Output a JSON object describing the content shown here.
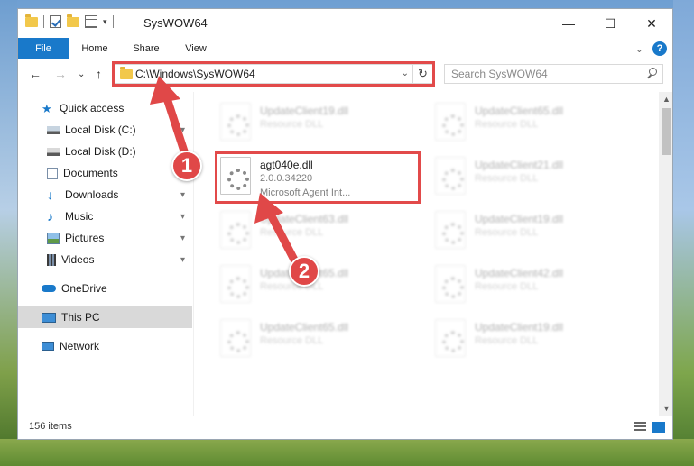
{
  "window": {
    "title": "SysWOW64",
    "minimize_glyph": "—",
    "maximize_glyph": "☐",
    "close_glyph": "✕"
  },
  "ribbon": {
    "tabs": [
      "File",
      "Home",
      "Share",
      "View"
    ],
    "collapse_glyph": "⌄",
    "help_glyph": "?"
  },
  "nav": {
    "back_glyph": "←",
    "forward_glyph": "→",
    "recent_glyph": "⌄",
    "up_glyph": "↑",
    "address": "C:\\Windows\\SysWOW64",
    "address_drop_glyph": "⌄",
    "refresh_glyph": "↻",
    "search_placeholder": "Search SysWOW64"
  },
  "sidebar": {
    "items": [
      {
        "label": "Quick access",
        "icon": "star-icon"
      },
      {
        "label": "Local Disk (C:)",
        "icon": "drive-icon",
        "pinned": true
      },
      {
        "label": "Local Disk (D:)",
        "icon": "drive-icon",
        "pinned": true
      },
      {
        "label": "Documents",
        "icon": "documents-icon",
        "pinned": true
      },
      {
        "label": "Downloads",
        "icon": "downloads-icon",
        "pinned": true
      },
      {
        "label": "Music",
        "icon": "music-icon",
        "pinned": true
      },
      {
        "label": "Pictures",
        "icon": "pictures-icon",
        "pinned": true
      },
      {
        "label": "Videos",
        "icon": "videos-icon",
        "pinned": true
      },
      {
        "label": "OneDrive",
        "icon": "onedrive-icon"
      },
      {
        "label": "This PC",
        "icon": "computer-icon",
        "selected": true
      },
      {
        "label": "Network",
        "icon": "network-icon"
      }
    ],
    "pin_glyph": "📌"
  },
  "files": {
    "left_column": [
      {
        "name": "UpdateClient19.dll",
        "desc": "Resource DLL"
      },
      {
        "name": "agt040e.dll",
        "version": "2.0.0.34220",
        "desc": "Microsoft Agent Int...",
        "highlighted": true
      },
      {
        "name": "UpdateClient63.dll",
        "desc": "Resource DLL"
      },
      {
        "name": "UpdateClient65.dll",
        "desc": "Resource DLL"
      },
      {
        "name": "UpdateClient65.dll",
        "desc": "Resource DLL"
      }
    ],
    "right_column": [
      {
        "name": "UpdateClient65.dll",
        "desc": "Resource DLL"
      },
      {
        "name": "UpdateClient21.dll",
        "desc": "Resource DLL"
      },
      {
        "name": "UpdateClient19.dll",
        "desc": "Resource DLL"
      },
      {
        "name": "UpdateClient42.dll",
        "desc": "Resource DLL"
      },
      {
        "name": "UpdateClient19.dll",
        "desc": "Resource DLL"
      }
    ]
  },
  "status": {
    "item_count": "156 items"
  },
  "annotations": {
    "badge1": "1",
    "badge2": "2",
    "highlight_color": "#e24a4a"
  },
  "colors": {
    "accent": "#1979ca",
    "selection": "#d9d9d9",
    "annotation_red": "#e04848"
  }
}
